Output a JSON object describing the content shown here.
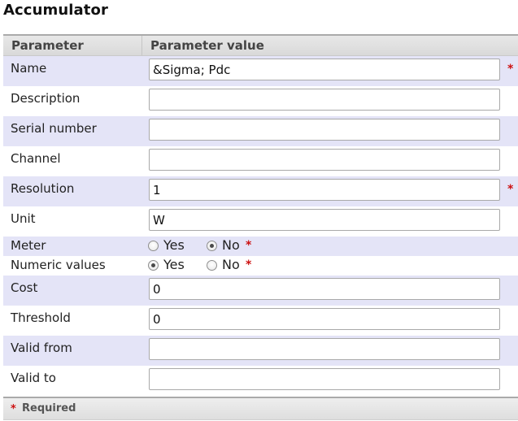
{
  "title": "Accumulator",
  "header": {
    "col1": "Parameter",
    "col2": "Parameter value"
  },
  "required_marker": "*",
  "fields": [
    {
      "label": "Name",
      "value": "&Sigma; Pdc",
      "required": true
    },
    {
      "label": "Description",
      "value": ""
    },
    {
      "label": "Serial number",
      "value": ""
    },
    {
      "label": "Channel",
      "value": ""
    },
    {
      "label": "Resolution",
      "value": "1",
      "required": true
    },
    {
      "label": "Unit",
      "value": "W"
    },
    {
      "label": "Meter",
      "options": [
        "Yes",
        "No"
      ],
      "selected": "No",
      "required": true
    },
    {
      "label": "Numeric values",
      "options": [
        "Yes",
        "No"
      ],
      "selected": "Yes",
      "required": true
    },
    {
      "label": "Cost",
      "value": "0"
    },
    {
      "label": "Threshold",
      "value": "0"
    },
    {
      "label": "Valid from",
      "value": ""
    },
    {
      "label": "Valid to",
      "value": ""
    }
  ],
  "footer": {
    "star": "*",
    "text": "Required"
  },
  "colors": {
    "shaded_row": "#e4e4f7",
    "required": "#cc1111"
  }
}
